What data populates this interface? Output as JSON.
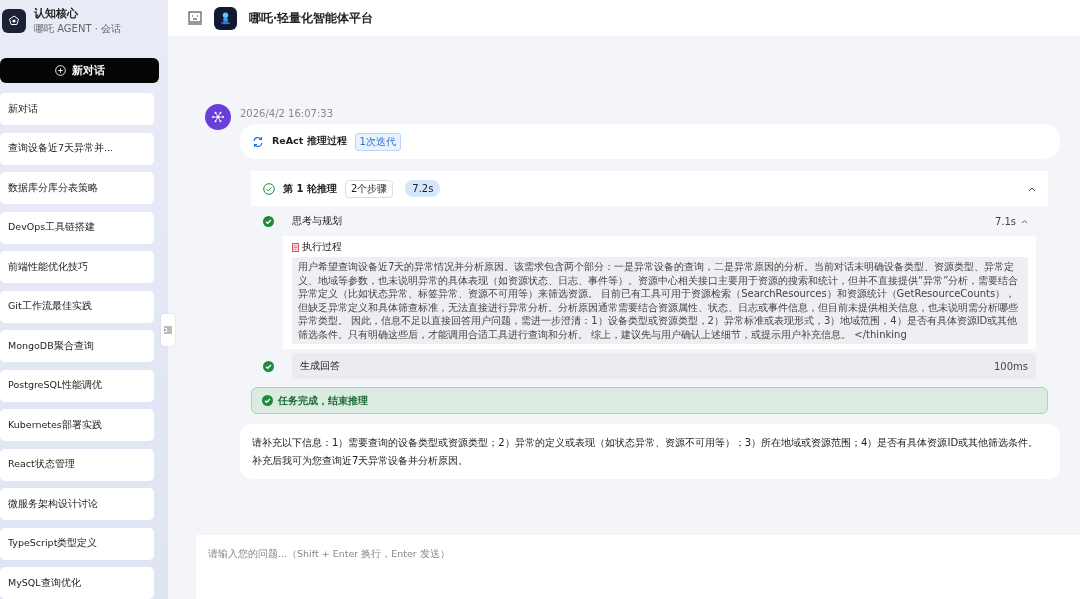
{
  "sidebar": {
    "brand": {
      "title": "认知核心",
      "subtitle": "哪吒 AGENT · 会话"
    },
    "new_chat_button": "新对话",
    "items": [
      {
        "label": "新对话"
      },
      {
        "label": "查询设备近7天异常并..."
      },
      {
        "label": "数据库分库分表策略"
      },
      {
        "label": "DevOps工具链搭建"
      },
      {
        "label": "前端性能优化技巧"
      },
      {
        "label": "Git工作流最佳实践"
      },
      {
        "label": "MongoDB聚合查询"
      },
      {
        "label": "PostgreSQL性能调优"
      },
      {
        "label": "Kubernetes部署实践"
      },
      {
        "label": "React状态管理"
      },
      {
        "label": "微服务架构设计讨论"
      },
      {
        "label": "TypeScript类型定义"
      },
      {
        "label": "MySQL查询优化"
      }
    ]
  },
  "header": {
    "title": "哪吒·轻量化智能体平台"
  },
  "message": {
    "timestamp": "2026/4/2 16:07:33",
    "react": {
      "title": "ReAct 推理过程",
      "badge": "1次迭代"
    },
    "round": {
      "title": "第 1 轮推理",
      "steps_badge": "2个步骤",
      "time_badge": "7.2s",
      "expanded": true,
      "steps": [
        {
          "title": "思考与规划",
          "time": "7.1s",
          "detail": {
            "title": "执行过程",
            "text": "用户希望查询设备近7天的异常情况并分析原因。该需求包含两个部分：一是异常设备的查询，二是异常原因的分析。当前对话未明确设备类型、资源类型、异常定义、地域等参数，也未说明异常的具体表现（如资源状态、日志、事件等）。资源中心相关接口主要用于资源的搜索和统计，但并不直接提供“异常”分析，需要结合异常定义（比如状态异常、标签异常、资源不可用等）来筛选资源。 目前已有工具可用于资源检索（SearchResources）和资源统计（GetResourceCounts），但缺乏异常定义和具体筛查标准，无法直接进行异常分析。分析原因通常需要结合资源属性、状态、日志或事件信息，但目前未提供相关信息，也未说明需分析哪些异常类型。 因此，信息不足以直接回答用户问题，需进一步澄清：1）设备类型或资源类型，2）异常标准或表现形式，3）地域范围，4）是否有具体资源ID或其他筛选条件。只有明确这些后，才能调用合适工具进行查询和分析。 综上，建议先与用户确认上述细节，或提示用户补充信息。 </thinking"
          }
        },
        {
          "title": "生成回答",
          "time": "100ms"
        }
      ]
    },
    "status": "任务完成，结束推理"
  },
  "answer": "请补充以下信息：1）需要查询的设备类型或资源类型；2）异常的定义或表现（如状态异常、资源不可用等）；3）所在地域或资源范围；4）是否有具体资源ID或其他筛选条件。补充后我可为您查询近7天异常设备并分析原因。",
  "input": {
    "placeholder": "请输入您的问题...（Shift + Enter 换行，Enter 发送）"
  }
}
